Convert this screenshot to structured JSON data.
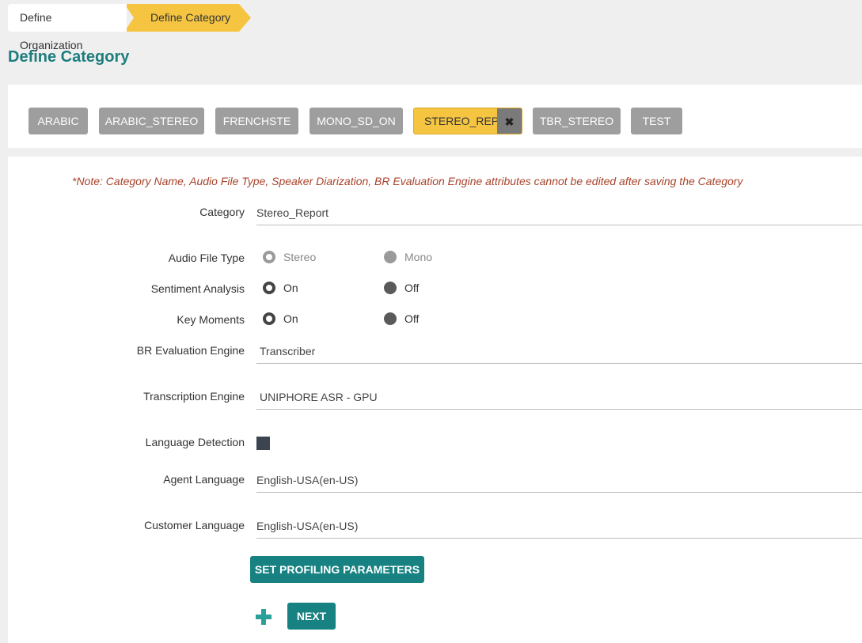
{
  "breadcrumb": {
    "items": [
      "Define Organization",
      "Define Category"
    ]
  },
  "page_title": "Define Category",
  "categories": {
    "items": [
      "ARABIC",
      "ARABIC_STEREO",
      "FRENCHSTE",
      "MONO_SD_ON",
      "STEREO_REPORT",
      "TBR_STEREO",
      "TEST"
    ],
    "selected": "STEREO_REPORT",
    "close_glyph": "✖"
  },
  "form": {
    "note": "*Note: Category Name, Audio File Type, Speaker Diarization, BR Evaluation Engine attributes cannot be edited after saving the Category",
    "category": {
      "label": "Category",
      "value": "Stereo_Report"
    },
    "audio_file_type": {
      "label": "Audio File Type",
      "options": [
        "Stereo",
        "Mono"
      ],
      "selected": "Stereo"
    },
    "sentiment_analysis": {
      "label": "Sentiment Analysis",
      "options": [
        "On",
        "Off"
      ],
      "selected": "On"
    },
    "key_moments": {
      "label": "Key Moments",
      "options": [
        "On",
        "Off"
      ],
      "selected": "On"
    },
    "br_engine": {
      "label": "BR Evaluation Engine",
      "value": "Transcriber"
    },
    "transcription_engine": {
      "label": "Transcription Engine",
      "value": "UNIPHORE ASR - GPU"
    },
    "language_detection": {
      "label": "Language Detection",
      "checked": true
    },
    "agent_language": {
      "label": "Agent Language",
      "value": "English-USA(en-US)"
    },
    "customer_language": {
      "label": "Customer Language",
      "value": "English-USA(en-US)"
    }
  },
  "buttons": {
    "set_profiling": "SET PROFILING PARAMETERS",
    "next": "NEXT"
  },
  "colors": {
    "accent": "#188282",
    "title": "#1d7d7d",
    "selected_chip": "#f5c542",
    "chip": "#9e9e9e",
    "note": "#a8432b"
  }
}
